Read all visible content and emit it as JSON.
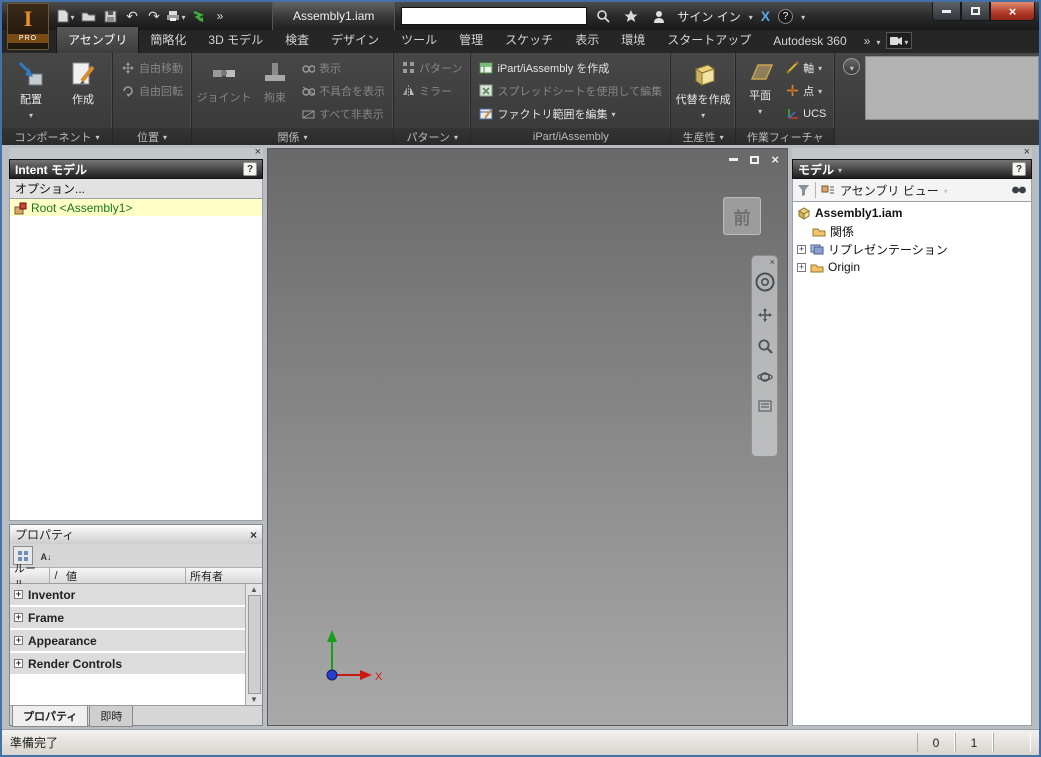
{
  "titlebar": {
    "badge": "PRO",
    "doc_title": "Assembly1.iam",
    "signin": "サイン イン",
    "overflow": "»"
  },
  "tabs": {
    "items": [
      "アセンブリ",
      "簡略化",
      "3D モデル",
      "検査",
      "デザイン",
      "ツール",
      "管理",
      "スケッチ",
      "表示",
      "環境",
      "スタートアップ",
      "Autodesk 360"
    ],
    "overflow": "»"
  },
  "ribbon": {
    "component": {
      "place": "配置",
      "create": "作成",
      "group_label": "コンポーネント"
    },
    "position": {
      "free_move": "自由移動",
      "free_rotate": "自由回転",
      "group_label": "位置"
    },
    "relations": {
      "joint": "ジョイント",
      "constrain": "拘束",
      "show": "表示",
      "show_sick": "不具合を表示",
      "hide_all": "すべて非表示",
      "group_label": "関係"
    },
    "pattern": {
      "pattern": "パターン",
      "mirror": "ミラー",
      "group_label": "パターン"
    },
    "ipart": {
      "create": "iPart/iAssembly を作成",
      "edit_spreadsheet": "スプレッドシートを使用して編集",
      "edit_factory": "ファクトリ範囲を編集",
      "group_label": "iPart/iAssembly"
    },
    "productivity": {
      "substitute": "代替を作成",
      "group_label": "生産性"
    },
    "work": {
      "plane": "平面",
      "axis": "軸",
      "point": "点",
      "ucs": "UCS",
      "group_label": "作業フィーチャ"
    }
  },
  "intent": {
    "title": "Intent モデル",
    "help": "?",
    "options": "オプション...",
    "root": "Root <Assembly1>"
  },
  "props": {
    "title": "プロパティ",
    "col_rule": "ルール",
    "col_slash": "/",
    "col_value": "値",
    "col_owner": "所有者",
    "rows": [
      "Inventor",
      "Frame",
      "Appearance",
      "Render Controls"
    ],
    "tab1": "プロパティ",
    "tab2": "即時"
  },
  "viewport": {
    "viewcube": "前"
  },
  "model": {
    "title": "モデル",
    "help": "?",
    "view": "アセンブリ ビュー",
    "root": "Assembly1.iam",
    "node1": "関係",
    "node2": "リプレゼンテーション",
    "node3": "Origin"
  },
  "status": {
    "message": "準備完了",
    "n0": "0",
    "n1": "1"
  },
  "colors": {
    "close_button": "#b33a28",
    "root_highlight": "#ffffc8",
    "root_text": "#1a7a1a",
    "titlebar_bg": "#2a2a2a",
    "ribbon_bg": "#3d3d3d"
  }
}
